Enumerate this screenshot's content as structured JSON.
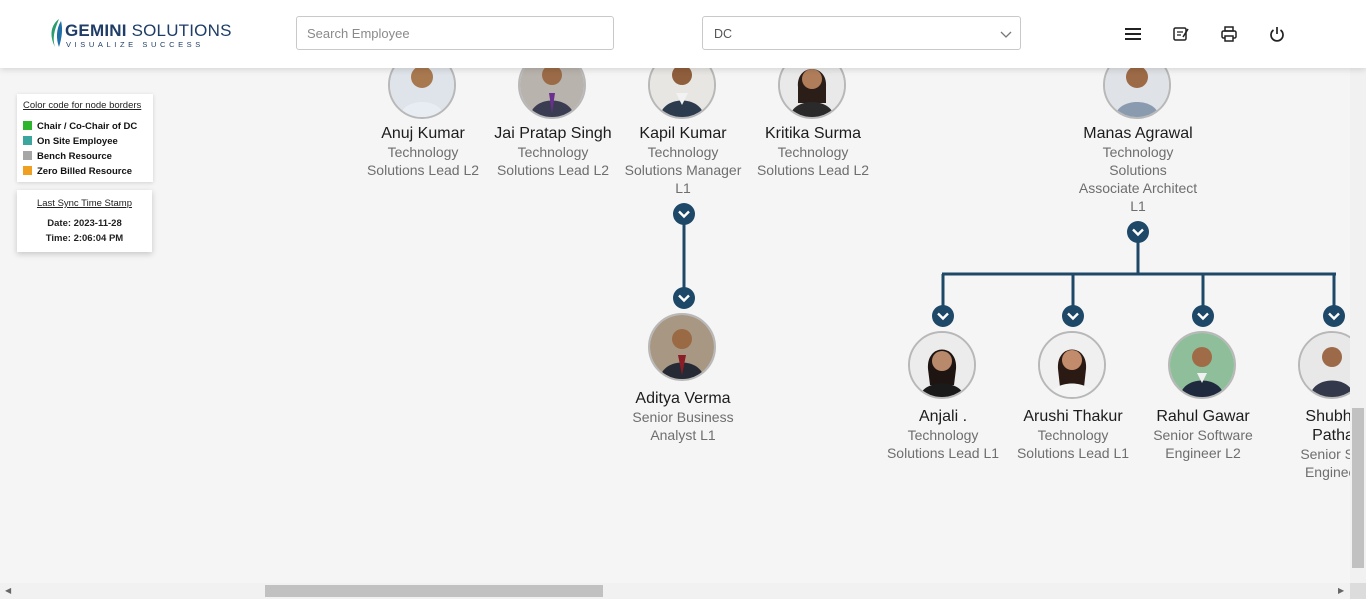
{
  "header": {
    "logo": {
      "name_bold": "GEMINI",
      "name_rest": " SOLUTIONS",
      "tagline": "VISUALIZE SUCCESS"
    },
    "search": {
      "placeholder": "Search Employee",
      "value": ""
    },
    "department_select": {
      "selected": "DC"
    },
    "icons": [
      "menu-icon",
      "notes-icon",
      "print-icon",
      "power-icon"
    ]
  },
  "legend": {
    "title": "Color code for node borders",
    "items": [
      {
        "label": "Chair / Co-Chair of DC",
        "color": "#2db52d"
      },
      {
        "label": "On Site Employee",
        "color": "#3aa69e"
      },
      {
        "label": "Bench Resource",
        "color": "#a6a6a6"
      },
      {
        "label": "Zero Billed Resource",
        "color": "#f0a020"
      }
    ]
  },
  "sync": {
    "title": "Last Sync Time Stamp",
    "date": "Date: 2023-11-28",
    "time": "Time: 2:06:04 PM"
  },
  "employees": [
    {
      "name": "Anuj Kumar",
      "title_lines": [
        "Technology",
        "Solutions Lead L2"
      ]
    },
    {
      "name": "Jai Pratap Singh",
      "title_lines": [
        "Technology",
        "Solutions Lead L2"
      ]
    },
    {
      "name": "Kapil Kumar",
      "title_lines": [
        "Technology",
        "Solutions Manager",
        "L1"
      ]
    },
    {
      "name": "Kritika Surma",
      "title_lines": [
        "Technology",
        "Solutions Lead L2"
      ]
    },
    {
      "name": "Manas Agrawal",
      "title_lines": [
        "Technology",
        "Solutions",
        "Associate Architect",
        "L1"
      ]
    },
    {
      "name": "Aditya Verma",
      "title_lines": [
        "Senior Business",
        "Analyst L1"
      ]
    },
    {
      "name": "Anjali .",
      "title_lines": [
        "Technology",
        "Solutions Lead L1"
      ]
    },
    {
      "name": "Arushi Thakur",
      "title_lines": [
        "Technology",
        "Solutions Lead L1"
      ]
    },
    {
      "name": "Rahul Gawar",
      "title_lines": [
        "Senior Software",
        "Engineer L2"
      ]
    },
    {
      "name": "Shubham Pathak",
      "name_lines": [
        "Shubha",
        "Patha"
      ],
      "title_lines": [
        "Senior Sof",
        "Engineer"
      ]
    }
  ],
  "colors": {
    "accent": "#1e4868",
    "avatar_border": "#b8b8b8"
  }
}
